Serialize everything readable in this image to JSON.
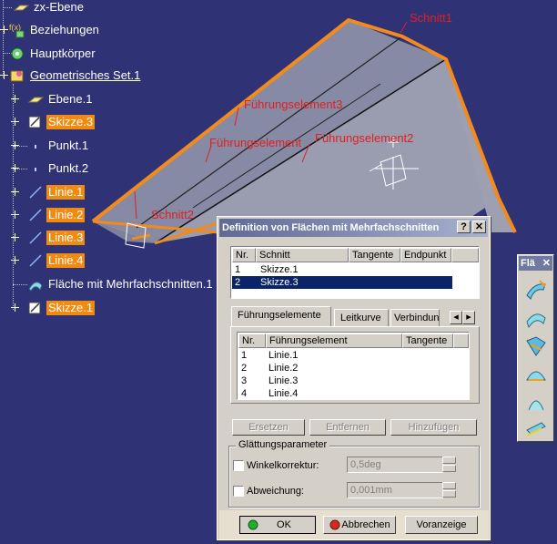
{
  "tree": {
    "items": [
      {
        "label": "zx-Ebene",
        "icon": "plane-icon",
        "highlight": false,
        "underline": false
      },
      {
        "label": "Beziehungen",
        "icon": "relations-icon",
        "highlight": false,
        "underline": false
      },
      {
        "label": "Hauptkörper",
        "icon": "body-icon",
        "highlight": false,
        "underline": false
      },
      {
        "label": "Geometrisches Set.1",
        "icon": "geometrical-set-icon",
        "highlight": false,
        "underline": true
      },
      {
        "label": "Ebene.1",
        "icon": "plane-icon",
        "highlight": false,
        "underline": false
      },
      {
        "label": "Skizze.3",
        "icon": "sketch-icon",
        "highlight": true,
        "underline": false
      },
      {
        "label": "Punkt.1",
        "icon": "point-icon",
        "highlight": false,
        "underline": false
      },
      {
        "label": "Punkt.2",
        "icon": "point-icon",
        "highlight": false,
        "underline": false
      },
      {
        "label": "Linie.1",
        "icon": "line-icon",
        "highlight": true,
        "underline": false
      },
      {
        "label": "Linie.2",
        "icon": "line-icon",
        "highlight": true,
        "underline": false
      },
      {
        "label": "Linie.3",
        "icon": "line-icon",
        "highlight": true,
        "underline": false
      },
      {
        "label": "Linie.4",
        "icon": "line-icon",
        "highlight": true,
        "underline": false
      },
      {
        "label": "Fläche mit Mehrfachschnitten.1",
        "icon": "multisection-surface-icon",
        "highlight": false,
        "underline": false
      },
      {
        "label": "Skizze.1",
        "icon": "sketch-icon",
        "highlight": true,
        "underline": false
      }
    ]
  },
  "viewport": {
    "labels": {
      "schnitt1": "Schnitt1",
      "schnitt2": "Schnitt2",
      "fuehrung1": "Führungselement",
      "fuehrung2": "Führungselement2",
      "fuehrung3": "Führungselement3"
    },
    "colors": {
      "highlight": "#f28a1c",
      "annotation": "#e02020",
      "background": "#2f3275"
    }
  },
  "dialog": {
    "title": "Definition von Flächen mit Mehrfachschnitten",
    "help_label": "?",
    "close_label": "✕",
    "sections": {
      "headers": [
        "Nr.",
        "Schnitt",
        "Tangente",
        "Endpunkt"
      ],
      "rows": [
        {
          "nr": "1",
          "name": "Skizze.1",
          "selected": false
        },
        {
          "nr": "2",
          "name": "Skizze.3",
          "selected": true
        }
      ]
    },
    "tabs": [
      "Führungselemente",
      "Leitkurve",
      "Verbindun"
    ],
    "guides": {
      "headers": [
        "Nr.",
        "Führungselement",
        "Tangente"
      ],
      "rows": [
        {
          "nr": "1",
          "name": "Linie.1"
        },
        {
          "nr": "2",
          "name": "Linie.2"
        },
        {
          "nr": "3",
          "name": "Linie.3"
        },
        {
          "nr": "4",
          "name": "Linie.4"
        }
      ]
    },
    "buttons": {
      "replace": "Ersetzen",
      "remove": "Entfernen",
      "add": "Hinzufügen"
    },
    "smoothing": {
      "title": "Glättungsparameter",
      "angle_label": "Winkelkorrektur:",
      "angle_value": "0,5deg",
      "deviation_label": "Abweichung:",
      "deviation_value": "0,001mm"
    },
    "footer": {
      "ok": "OK",
      "cancel": "Abbrechen",
      "preview": "Voranzeige"
    }
  },
  "toolbar": {
    "title": "Flä",
    "close_label": "✕",
    "tools": [
      "sweep-icon",
      "multisection-surface-icon",
      "blend-icon",
      "fill-icon",
      "extrude-icon",
      "offset-icon"
    ]
  }
}
